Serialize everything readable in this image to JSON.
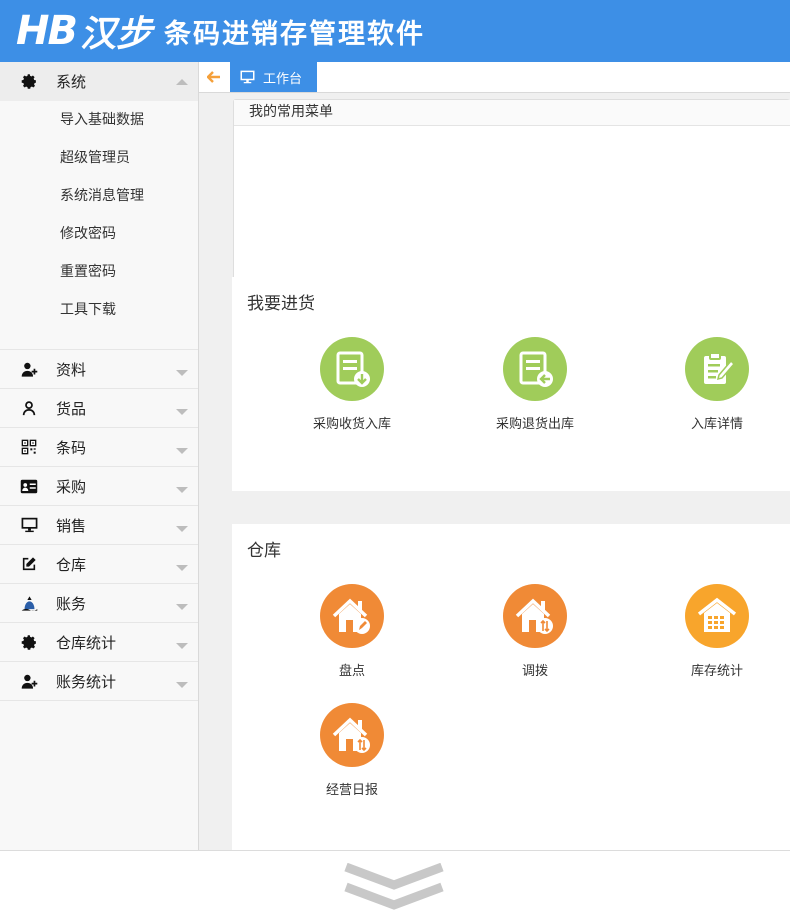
{
  "header": {
    "logo_latin": "HB",
    "logo_cn": "汉步",
    "title": "条码进销存管理软件",
    "bg_color": "#3d8fe6"
  },
  "sidebar": {
    "groups": [
      {
        "label": "系统",
        "icon": "gear-icon",
        "expanded": true,
        "items": [
          "导入基础数据",
          "超级管理员",
          "系统消息管理",
          "修改密码",
          "重置密码",
          "工具下载"
        ]
      },
      {
        "label": "资料",
        "icon": "user-add-icon",
        "expanded": false
      },
      {
        "label": "货品",
        "icon": "person-icon",
        "expanded": false
      },
      {
        "label": "条码",
        "icon": "qrcode-icon",
        "expanded": false
      },
      {
        "label": "采购",
        "icon": "id-card-icon",
        "expanded": false
      },
      {
        "label": "销售",
        "icon": "monitor-icon",
        "expanded": false
      },
      {
        "label": "仓库",
        "icon": "edit-icon",
        "expanded": false
      },
      {
        "label": "账务",
        "icon": "money-bag-icon",
        "expanded": false
      },
      {
        "label": "仓库统计",
        "icon": "gear-icon",
        "expanded": false
      },
      {
        "label": "账务统计",
        "icon": "user-add-icon",
        "expanded": false
      }
    ]
  },
  "tabs": {
    "active_label": "工作台"
  },
  "favorites": {
    "title": "我的常用菜单"
  },
  "purchase": {
    "title": "我要进货",
    "items": [
      {
        "label": "采购收货入库",
        "icon": "doc-download-icon",
        "color": "#a0cc5a"
      },
      {
        "label": "采购退货出库",
        "icon": "doc-return-icon",
        "color": "#a0cc5a"
      },
      {
        "label": "入库详情",
        "icon": "clipboard-edit-icon",
        "color": "#a0cc5a"
      }
    ]
  },
  "warehouse": {
    "title": "仓库",
    "items": [
      {
        "label": "盘点",
        "icon": "house-pen-icon",
        "color": "#f08a36"
      },
      {
        "label": "调拨",
        "icon": "house-transfer-icon",
        "color": "#f08a36"
      },
      {
        "label": "库存统计",
        "icon": "warehouse-grid-icon",
        "color": "#f8a52c"
      },
      {
        "label": "经营日报",
        "icon": "house-transfer-icon",
        "color": "#f08a36"
      }
    ]
  }
}
